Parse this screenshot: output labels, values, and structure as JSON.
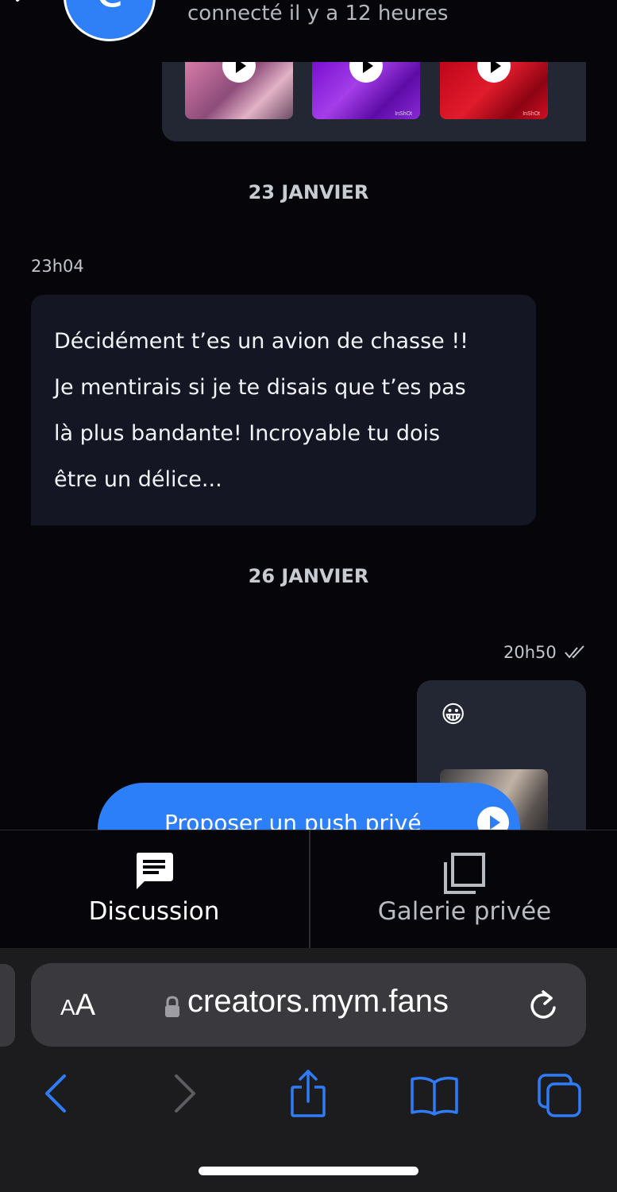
{
  "header": {
    "avatar_letter": "c",
    "status": "connecté il y a 12 heures"
  },
  "media_thumbs": [
    {
      "name": "video-1",
      "watermark": ""
    },
    {
      "name": "video-2",
      "watermark": "InShOt"
    },
    {
      "name": "video-3",
      "watermark": "InShOt"
    }
  ],
  "conversation": {
    "date_1": "23 JANVIER",
    "msg1_time": "23h04",
    "msg1_lines": [
      "Décidément t’es un avion de chasse !!",
      "Je mentirais si je te disais que t’es pas",
      "là plus bandante! Incroyable tu dois",
      "être un délice..."
    ],
    "date_2": "26 JANVIER",
    "msg2_time": "20h50",
    "msg2_emoji": "😀"
  },
  "push_button": {
    "label": "Proposer un push privé"
  },
  "tabs": [
    {
      "label": "Discussion",
      "active": true,
      "icon": "chat-icon"
    },
    {
      "label": "Galerie privée",
      "active": false,
      "icon": "gallery-icon"
    }
  ],
  "browser": {
    "aa_label_big": "A",
    "aa_label_small": "A",
    "url": "creators.mym.fans",
    "accent": "#2f7cf6"
  }
}
